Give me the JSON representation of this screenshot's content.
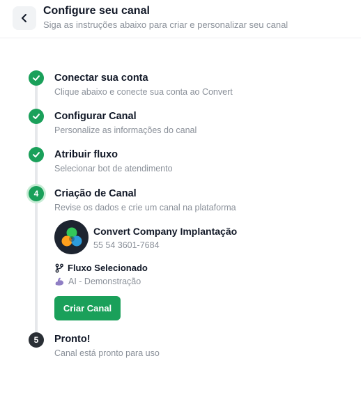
{
  "header": {
    "title": "Configure seu canal",
    "subtitle": "Siga as instruções abaixo para criar e personalizar seu canal",
    "back_icon": "chevron-left-icon"
  },
  "steps": [
    {
      "status": "done",
      "marker": "",
      "title": "Conectar sua conta",
      "description": "Clique abaixo e conecte sua conta ao Convert"
    },
    {
      "status": "done",
      "marker": "",
      "title": "Configurar Canal",
      "description": "Personalize as informações do canal"
    },
    {
      "status": "done",
      "marker": "",
      "title": "Atribuir fluxo",
      "description": "Selecionar bot de atendimento"
    },
    {
      "status": "active",
      "marker": "4",
      "title": "Criação de Canal",
      "description": "Revise os dados e crie um canal na plataforma"
    },
    {
      "status": "pending",
      "marker": "5",
      "title": "Pronto!",
      "description": "Canal está pronto para uso"
    }
  ],
  "channel": {
    "name": "Convert Company Implantação",
    "phone": "55 54 3601-7684"
  },
  "flow": {
    "label": "Fluxo Selecionado",
    "label_icon": "git-branch-icon",
    "value": "AI - Demonstração",
    "value_icon": "flexed-arm-icon"
  },
  "actions": {
    "create_label": "Criar Canal"
  },
  "colors": {
    "accent": "#1aa05a",
    "accent_ring": "#c7ecd5",
    "pending": "#2a2f35",
    "muted_text": "#8a9099"
  }
}
